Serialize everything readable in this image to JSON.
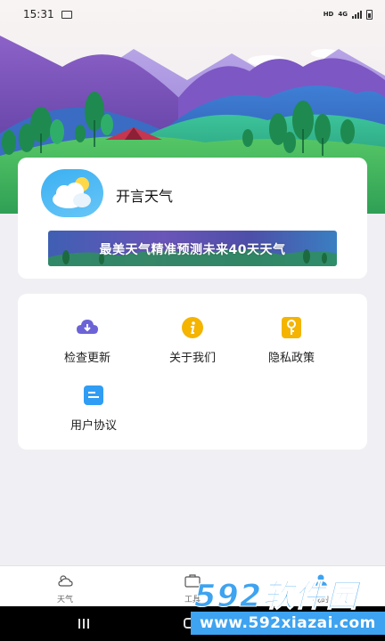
{
  "status_bar": {
    "time": "15:31",
    "network": "HD",
    "signal_type": "4G",
    "icons": [
      "image-icon",
      "signal-icon",
      "battery-icon"
    ]
  },
  "app_card": {
    "app_name": "开言天气",
    "banner_text": "最美天气精准预测未来40天天气"
  },
  "menu": {
    "items": [
      {
        "label": "检查更新",
        "icon": "cloud-download-icon",
        "color": "#6b63d6"
      },
      {
        "label": "关于我们",
        "icon": "info-icon",
        "color": "#f4b400"
      },
      {
        "label": "隐私政策",
        "icon": "key-icon",
        "color": "#f4b400"
      },
      {
        "label": "用户协议",
        "icon": "document-icon",
        "color": "#2f9df4"
      }
    ]
  },
  "bottom_nav": {
    "items": [
      {
        "label": "天气",
        "icon": "weather-icon"
      },
      {
        "label": "工具",
        "icon": "toolbox-icon"
      },
      {
        "label": "我的",
        "icon": "user-icon"
      }
    ]
  },
  "watermark": {
    "brand_number": "592",
    "brand_cn": "软件园",
    "url": "www.592xiazai.com"
  },
  "colors": {
    "background": "#f0eff4",
    "card": "#ffffff",
    "accent": "#3ea3f0"
  }
}
